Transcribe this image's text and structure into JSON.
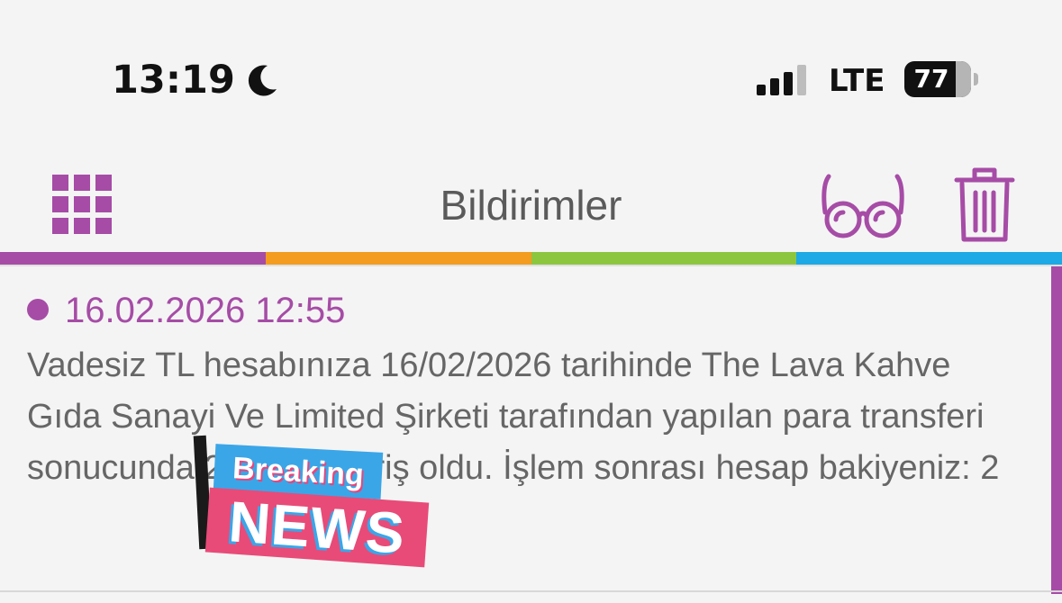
{
  "status_bar": {
    "time": "13:19",
    "network": "LTE",
    "battery_percent": "77",
    "battery_level": 77,
    "signal_bars_active": 3,
    "signal_bars_total": 4,
    "icons": [
      "moon-icon",
      "signal-icon",
      "battery-icon"
    ]
  },
  "header": {
    "title": "Bildirimler",
    "icons": [
      "grid-menu-icon",
      "glasses-icon",
      "trash-icon"
    ]
  },
  "colors": {
    "accent": "#a64ca6",
    "stripe": [
      "#a64ca6",
      "#f39c1f",
      "#8cc63f",
      "#1ca9e6"
    ],
    "text": "#666666",
    "background": "#f4f4f4"
  },
  "notifications": [
    {
      "unread": true,
      "date": "16.02.2026 12:55",
      "body": "Vadesiz TL hesabınıza 16/02/2026 tarihinde The Lava Kahve Gıda Sanayi Ve Limited Şirketi tarafından yapılan para transferi sonucunda 2.000 TL giriş oldu. İşlem sonrası hesap bakiyeniz: 2"
    }
  ],
  "sticker": {
    "line1": "Breaking",
    "line2": "NEWS"
  }
}
